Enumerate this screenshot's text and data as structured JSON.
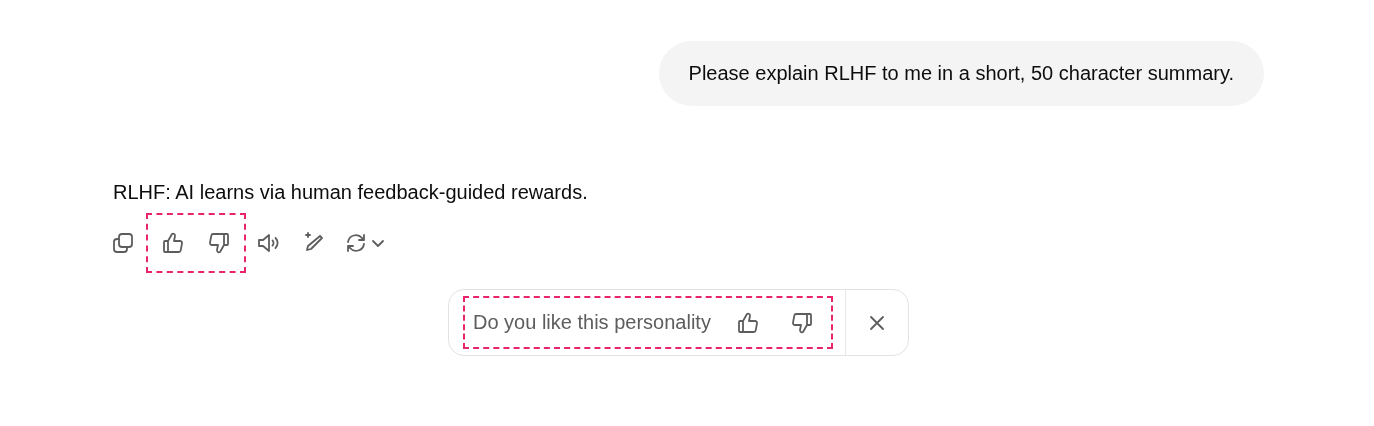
{
  "user_message": {
    "text": "Please explain RLHF to me in a short, 50 character summary."
  },
  "assistant_message": {
    "text": "RLHF: AI learns via human feedback-guided rewards."
  },
  "message_actions": {
    "rating_highlighted": true
  },
  "feedback_bar": {
    "question": "Do you like this personality",
    "highlighted": true
  }
}
